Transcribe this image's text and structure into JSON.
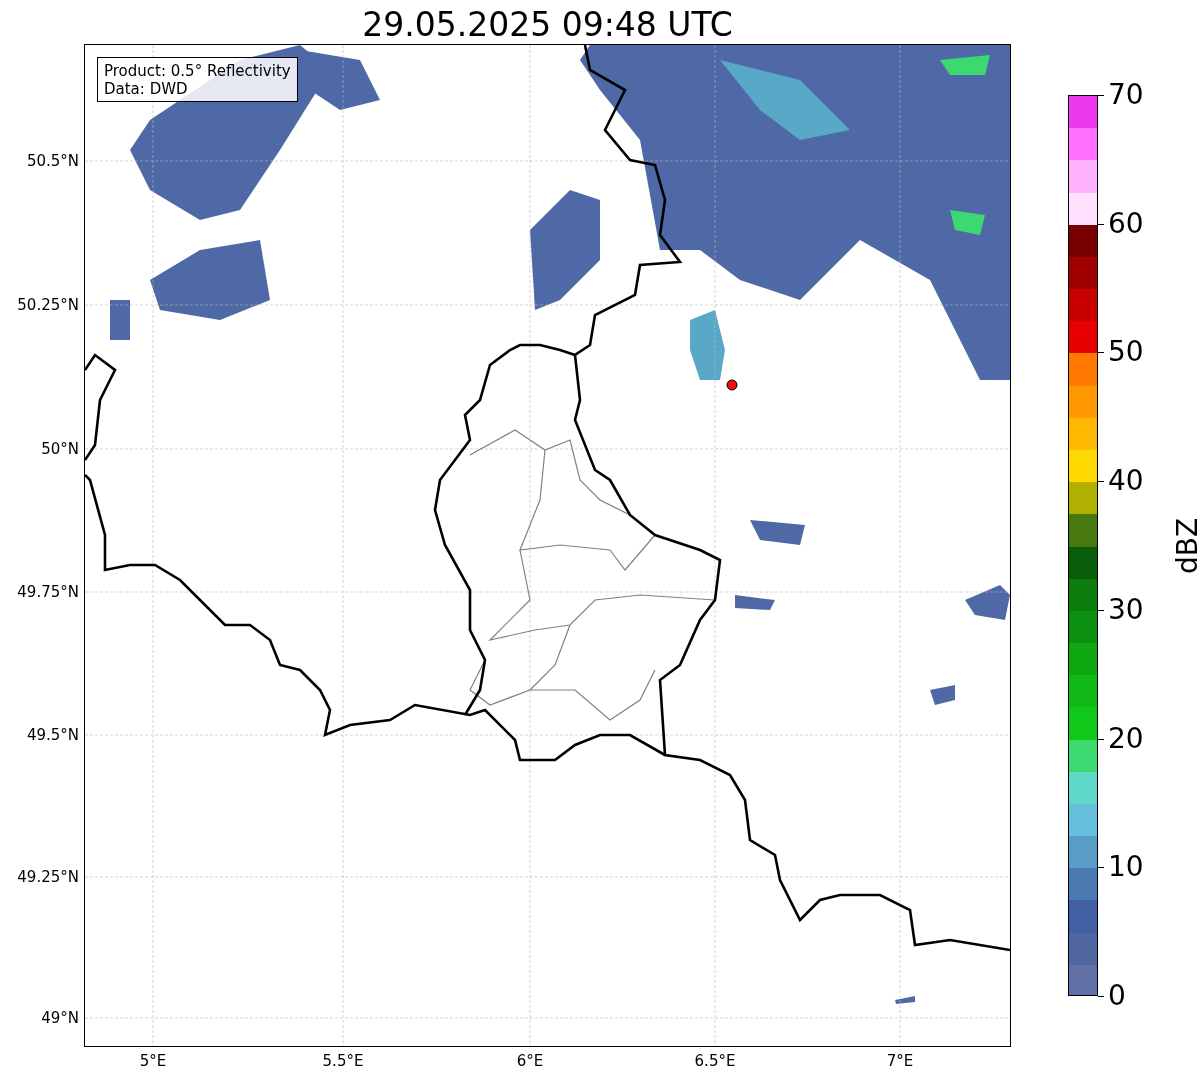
{
  "title": "29.05.2025 09:48 UTC",
  "legend_box": {
    "lines": [
      "Product: 0.5° Reflectivity",
      "Data: DWD"
    ]
  },
  "map": {
    "x_ticks": [
      "5°E",
      "5.5°E",
      "6°E",
      "6.5°E",
      "7°E"
    ],
    "y_ticks": [
      "50.5°N",
      "50.25°N",
      "50°N",
      "49.75°N",
      "49.5°N",
      "49.25°N",
      "49°N"
    ]
  },
  "colorbar": {
    "label": "dBZ",
    "ticks": [
      "70",
      "60",
      "50",
      "40",
      "30",
      "20",
      "10",
      "0"
    ],
    "bins": [
      {
        "color": "#ee38ee"
      },
      {
        "color": "#ff70ff"
      },
      {
        "color": "#ffb0ff"
      },
      {
        "color": "#ffe0ff"
      },
      {
        "color": "#780000"
      },
      {
        "color": "#a00000"
      },
      {
        "color": "#c80000"
      },
      {
        "color": "#e80000"
      },
      {
        "color": "#ff7800"
      },
      {
        "color": "#ff9800"
      },
      {
        "color": "#ffb800"
      },
      {
        "color": "#ffd800"
      },
      {
        "color": "#b0b000"
      },
      {
        "color": "#487810"
      },
      {
        "color": "#0a5e0a"
      },
      {
        "color": "#0c7c0c"
      },
      {
        "color": "#0c9010"
      },
      {
        "color": "#10a810"
      },
      {
        "color": "#10b818"
      },
      {
        "color": "#10c818"
      },
      {
        "color": "#3cd870"
      },
      {
        "color": "#60d8c8"
      },
      {
        "color": "#66c0dc"
      },
      {
        "color": "#5a9ec8"
      },
      {
        "color": "#4a7ab0"
      },
      {
        "color": "#4460a4"
      },
      {
        "color": "#5066a0"
      },
      {
        "color": "#6070a4"
      }
    ]
  }
}
